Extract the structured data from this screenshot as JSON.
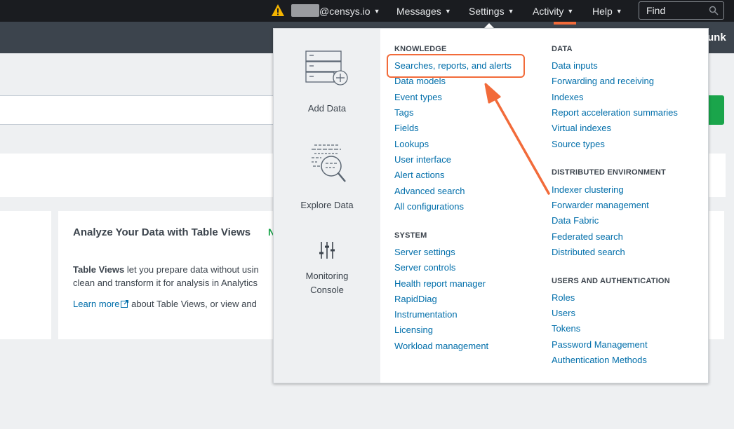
{
  "topbar": {
    "user": "@censys.io",
    "messages": "Messages",
    "settings": "Settings",
    "activity": "Activity",
    "help": "Help",
    "find_placeholder": "Find"
  },
  "app": {
    "name_partial": "unk"
  },
  "card": {
    "title": "Analyze Your Data with Table Views",
    "badge_partial": "N",
    "p1_bold": "Table Views",
    "p1_rest_line1": " let you prepare data without usin",
    "p1_line2": "clean and transform it for analysis in Analytics",
    "learn_more": "Learn more",
    "learn_rest": " about Table Views, or view and"
  },
  "menu": {
    "tiles": [
      {
        "label": "Add Data"
      },
      {
        "label": "Explore Data"
      },
      {
        "label_line1": "Monitoring",
        "label_line2": "Console"
      }
    ],
    "knowledge": {
      "heading": "KNOWLEDGE",
      "items": [
        "Searches, reports, and alerts",
        "Data models",
        "Event types",
        "Tags",
        "Fields",
        "Lookups",
        "User interface",
        "Alert actions",
        "Advanced search",
        "All configurations"
      ]
    },
    "system": {
      "heading": "SYSTEM",
      "items": [
        "Server settings",
        "Server controls",
        "Health report manager",
        "RapidDiag",
        "Instrumentation",
        "Licensing",
        "Workload management"
      ]
    },
    "data": {
      "heading": "DATA",
      "items": [
        "Data inputs",
        "Forwarding and receiving",
        "Indexes",
        "Report acceleration summaries",
        "Virtual indexes",
        "Source types"
      ]
    },
    "distributed": {
      "heading": "DISTRIBUTED ENVIRONMENT",
      "items": [
        "Indexer clustering",
        "Forwarder management",
        "Data Fabric",
        "Federated search",
        "Distributed search"
      ]
    },
    "users": {
      "heading": "USERS AND AUTHENTICATION",
      "items": [
        "Roles",
        "Users",
        "Tokens",
        "Password Management",
        "Authentication Methods"
      ]
    }
  },
  "colors": {
    "link": "#006eaa",
    "highlight": "#f26b3a",
    "topbar": "#1a1c20",
    "appbar": "#3c444d",
    "go_button": "#1aa54b"
  }
}
